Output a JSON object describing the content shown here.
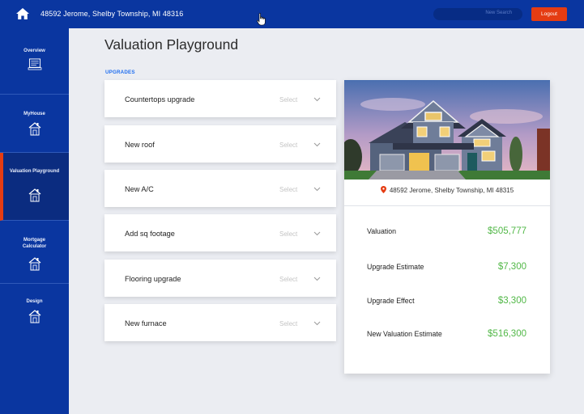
{
  "header": {
    "address": "48592 Jerome, Shelby Township, MI 48316",
    "search_placeholder": "New Search",
    "logout_label": "Logout"
  },
  "sidebar": {
    "items": [
      {
        "label": "Overview",
        "icon": "document-icon"
      },
      {
        "label": "MyHouse",
        "icon": "house-icon"
      },
      {
        "label": "Valuation Playground",
        "icon": "house-icon",
        "active": true
      },
      {
        "label": "Mortgage Calculator",
        "icon": "house-icon"
      },
      {
        "label": "Design",
        "icon": "house-icon"
      }
    ]
  },
  "main": {
    "title": "Valuation Playground",
    "section_label": "UPGRADES",
    "upgrades": [
      {
        "label": "Countertops upgrade",
        "select": "Select"
      },
      {
        "label": "New roof",
        "select": "Select"
      },
      {
        "label": "New A/C",
        "select": "Select"
      },
      {
        "label": "Add sq footage",
        "select": "Select"
      },
      {
        "label": "Flooring upgrade",
        "select": "Select"
      },
      {
        "label": "New furnace",
        "select": "Select"
      }
    ]
  },
  "card": {
    "address": "48592 Jerome, Shelby Township, MI 48315",
    "rows": [
      {
        "label": "Valuation",
        "value": "$505,777"
      },
      {
        "label": "Upgrade Estimate",
        "value": "$7,300"
      },
      {
        "label": "Upgrade Effect",
        "value": "$3,300"
      },
      {
        "label": "New Valuation Estimate",
        "value": "$516,300"
      }
    ]
  },
  "colors": {
    "primary": "#0a36a0",
    "accent": "#e53c12",
    "value_green": "#52b848",
    "section_blue": "#1f6ef0"
  }
}
